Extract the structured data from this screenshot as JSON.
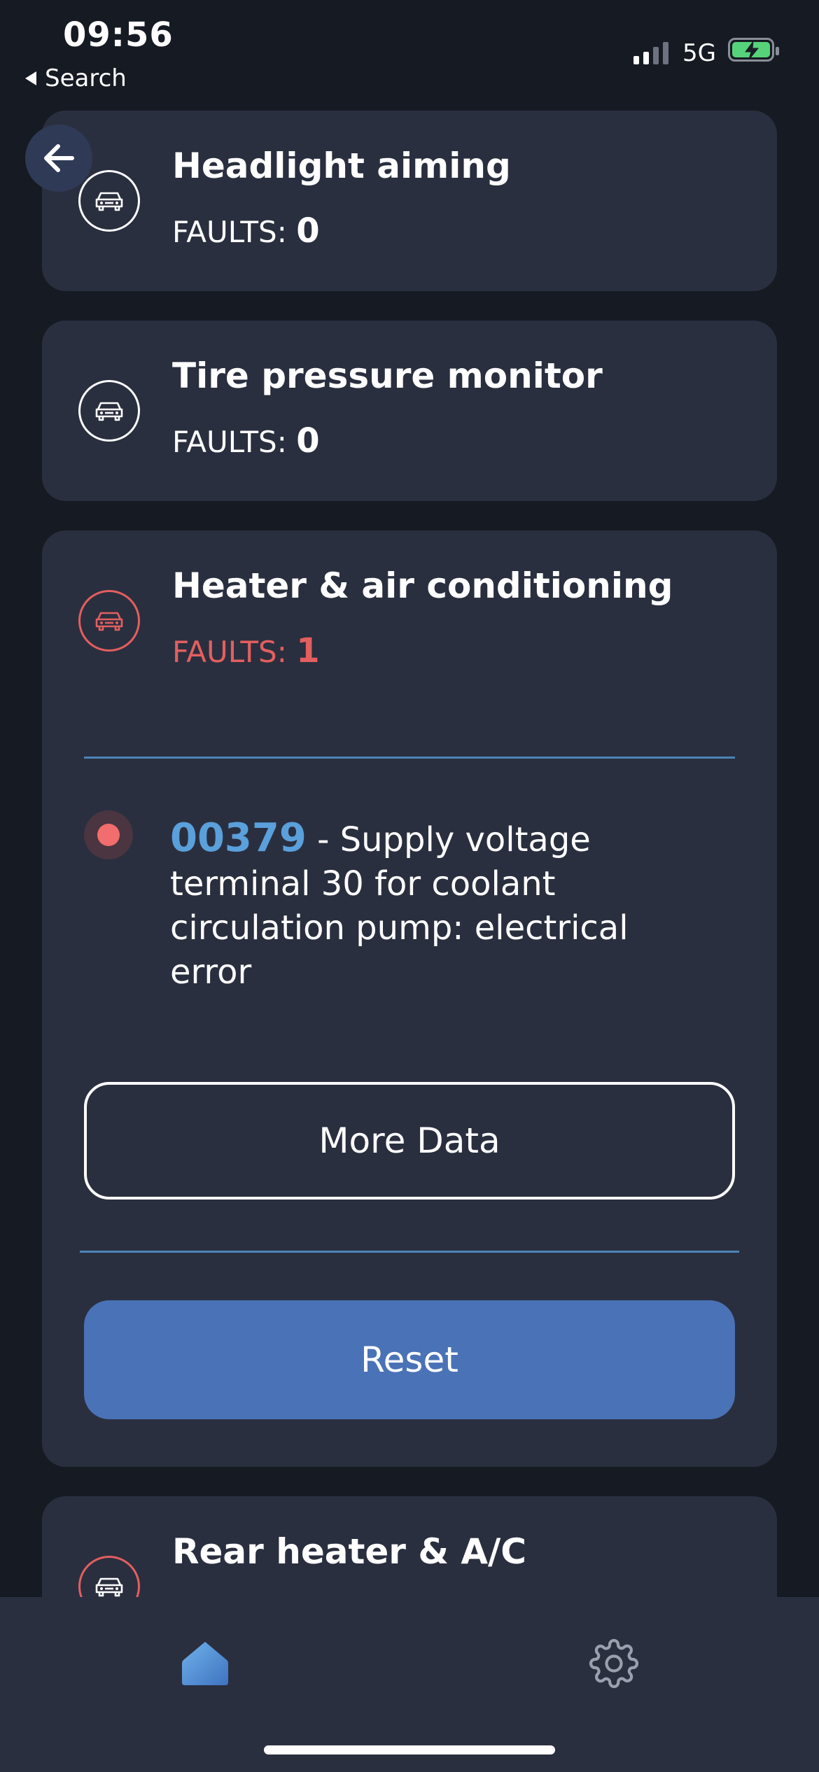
{
  "status_bar": {
    "time": "09:56",
    "back_app_label": "Search",
    "network": "5G",
    "battery_color": "#56d37a"
  },
  "cards": [
    {
      "title": "Headlight aiming",
      "faults_label": "FAULTS:",
      "faults_count": "0",
      "icon": "car-icon"
    },
    {
      "title": "Tire pressure monitor",
      "faults_label": "FAULTS:",
      "faults_count": "0",
      "icon": "car-icon"
    },
    {
      "title": "Heater & air conditioning",
      "faults_label": "FAULTS:",
      "faults_count": "1",
      "icon": "car-icon",
      "fault": {
        "code": "00379",
        "description": " - Supply voltage terminal 30 for coolant circulation pump: electrical error"
      },
      "more_data_label": "More Data",
      "reset_label": "Reset"
    },
    {
      "title": "Rear heater & A/C",
      "icon": "car-icon"
    }
  ],
  "tab_bar": {
    "tabs": [
      {
        "name": "home",
        "icon": "home-icon",
        "active": true
      },
      {
        "name": "settings",
        "icon": "gear-icon",
        "active": false
      }
    ]
  },
  "colors": {
    "background": "#161a22",
    "card": "#2a2f3f",
    "accent_blue": "#5aa0db",
    "button_blue": "#4a72b6",
    "fault_red": "#e35f5f"
  }
}
